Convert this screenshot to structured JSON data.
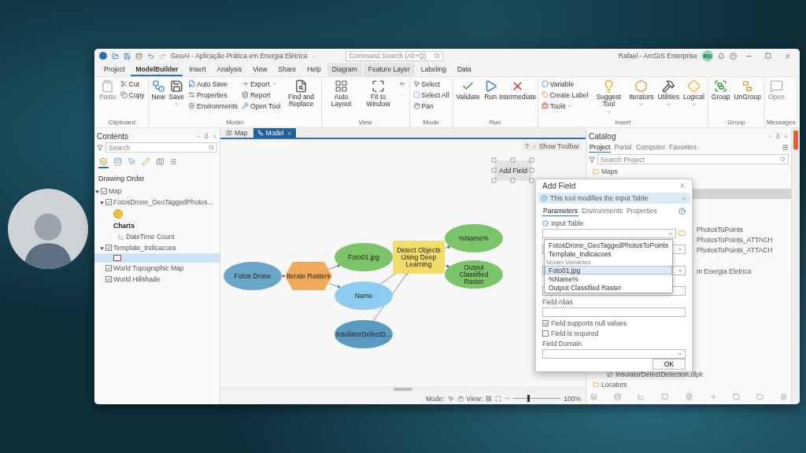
{
  "window": {
    "title": "GeoAI - Aplicação Prática em Energia Elétrica",
    "command_search": {
      "placeholder": "Command Search (Alt+Q)"
    },
    "user": "Rafael - ArcGIS Enterprise",
    "avatar": "RD"
  },
  "menu_tabs": [
    {
      "label": "Project",
      "selected": false,
      "kind": "plain"
    },
    {
      "label": "ModelBuilder",
      "selected": true,
      "kind": "plain"
    },
    {
      "label": "Insert",
      "selected": false,
      "kind": "plain"
    },
    {
      "label": "Analysis",
      "selected": false,
      "kind": "plain"
    },
    {
      "label": "View",
      "selected": false,
      "kind": "plain"
    },
    {
      "label": "Share",
      "selected": false,
      "kind": "plain"
    },
    {
      "label": "Help",
      "selected": false,
      "kind": "plain"
    },
    {
      "label": "Diagram",
      "selected": false,
      "kind": "contextual"
    },
    {
      "label": "Feature Layer",
      "selected": false,
      "kind": "contextual"
    },
    {
      "label": "Labeling",
      "selected": false,
      "kind": "plain"
    },
    {
      "label": "Data",
      "selected": false,
      "kind": "plain"
    }
  ],
  "ribbon": [
    {
      "label": "Clipboard",
      "items": [
        {
          "kind": "large",
          "label": "Paste",
          "disabled": true,
          "dropdown": false
        },
        {
          "kind": "small",
          "label": "Cut",
          "disabled": false,
          "dropdown": false
        },
        {
          "kind": "small",
          "label": "Copy",
          "disabled": false,
          "dropdown": false
        }
      ]
    },
    {
      "label": "Model",
      "items": [
        {
          "kind": "large",
          "label": "New",
          "disabled": false,
          "dropdown": false
        },
        {
          "kind": "large",
          "label": "Save",
          "disabled": false,
          "dropdown": true
        },
        {
          "kind": "small",
          "label": "Auto Save",
          "disabled": false,
          "dropdown": false
        },
        {
          "kind": "small",
          "label": "Properties",
          "disabled": false,
          "dropdown": false
        },
        {
          "kind": "small",
          "label": "Environments",
          "disabled": false,
          "dropdown": false
        },
        {
          "kind": "small",
          "label": "Export",
          "disabled": false,
          "dropdown": true
        },
        {
          "kind": "small",
          "label": "Report",
          "disabled": false,
          "dropdown": false
        },
        {
          "kind": "small",
          "label": "Open Tool",
          "disabled": false,
          "dropdown": false
        },
        {
          "kind": "large",
          "label": "Find and Replace",
          "disabled": false,
          "dropdown": false
        }
      ]
    },
    {
      "label": "View",
      "items": [
        {
          "kind": "large",
          "label": "Auto Layout",
          "disabled": false,
          "dropdown": false
        },
        {
          "kind": "large",
          "label": "Fit to Window",
          "disabled": false,
          "dropdown": false
        },
        {
          "kind": "small",
          "disabled": false,
          "dropdown": false
        },
        {
          "kind": "small",
          "disabled": true,
          "dropdown": false
        }
      ]
    },
    {
      "label": "Mode",
      "items": [
        {
          "kind": "small",
          "label": "Select",
          "disabled": false,
          "dropdown": false
        },
        {
          "kind": "small",
          "label": "Select All",
          "disabled": false,
          "dropdown": false
        },
        {
          "kind": "small",
          "label": "Pan",
          "disabled": false,
          "dropdown": false
        }
      ]
    },
    {
      "label": "Run",
      "items": [
        {
          "kind": "large",
          "label": "Validate",
          "disabled": false,
          "dropdown": false
        },
        {
          "kind": "large",
          "label": "Run",
          "disabled": false,
          "dropdown": false
        },
        {
          "kind": "large",
          "label": "Intermediate",
          "disabled": false,
          "dropdown": false
        }
      ]
    },
    {
      "label": "Insert",
      "items": [
        {
          "kind": "small",
          "label": "Variable",
          "disabled": false,
          "dropdown": false
        },
        {
          "kind": "small",
          "label": "Create Label",
          "disabled": false,
          "dropdown": false
        },
        {
          "kind": "small",
          "label": "Tools",
          "disabled": false,
          "dropdown": true
        },
        {
          "kind": "large",
          "label": "Suggest Tool",
          "disabled": false,
          "dropdown": true
        },
        {
          "kind": "large",
          "label": "Iterators",
          "disabled": false,
          "dropdown": true
        },
        {
          "kind": "large",
          "label": "Utilities",
          "disabled": false,
          "dropdown": true
        },
        {
          "kind": "large",
          "label": "Logical",
          "disabled": false,
          "dropdown": true
        }
      ]
    },
    {
      "label": "Group",
      "items": [
        {
          "kind": "large",
          "label": "Group",
          "disabled": false,
          "dropdown": false
        },
        {
          "kind": "large",
          "label": "UnGroup",
          "disabled": false,
          "dropdown": false
        }
      ]
    },
    {
      "label": "Messages",
      "items": [
        {
          "kind": "large",
          "label": "Open",
          "disabled": true,
          "dropdown": false
        }
      ]
    }
  ],
  "contents": {
    "title": "Contents",
    "search": {
      "placeholder": "Search"
    },
    "heading": "Drawing Order",
    "tree": [
      {
        "kind": "layer",
        "label": "Map",
        "checked": true,
        "expanded": true,
        "children": [
          {
            "kind": "layer",
            "label": "FotosDrone_GeoTaggedPhotos...",
            "checked": true,
            "expanded": true,
            "children": [
              {
                "kind": "symbol",
                "selected": false
              },
              {
                "kind": "heading",
                "label": "Charts"
              },
              {
                "kind": "chart",
                "label": "DateTime Count"
              }
            ]
          },
          {
            "kind": "layer",
            "label": "Template_Indicacoes",
            "checked": true,
            "expanded": true,
            "children": [
              {
                "kind": "symbol",
                "selected": true
              }
            ]
          },
          {
            "kind": "layer",
            "label": "World Topographic Map",
            "checked": true
          },
          {
            "kind": "layer",
            "label": "World Hillshade",
            "checked": true
          }
        ]
      }
    ]
  },
  "canvas": {
    "tabs": [
      {
        "label": "Map",
        "selected": false,
        "closable": false
      },
      {
        "label": "Model",
        "selected": true,
        "closable": true
      }
    ],
    "help": "?",
    "toolbar_toggle": "Show Toolbar",
    "nodes": [
      {
        "kind": "ellipse",
        "label": "Fotos Drone",
        "color": "#6aa6c8"
      },
      {
        "kind": "hexagon",
        "label": "Iterate Rasters",
        "color": "#f0aa5a"
      },
      {
        "kind": "ellipse",
        "label": "Foto01.jpg",
        "color": "#7cc46a"
      },
      {
        "kind": "ellipse",
        "label": "Name",
        "color": "#8ecbf0"
      },
      {
        "kind": "ellipse",
        "label": "InsulatorDefectD...",
        "color": "#5b9ac0"
      },
      {
        "kind": "rect",
        "label": "Detect Objects Using Deep Learning",
        "color": "#f2dc6a"
      },
      {
        "kind": "ellipse",
        "label": "%Name%",
        "color": "#7cc46a"
      },
      {
        "kind": "ellipse",
        "label": "Output Classified Raster",
        "color": "#7cc46a"
      },
      {
        "kind": "selected-tool",
        "label": "Add Field",
        "color": "#e2e2e2"
      }
    ],
    "status": {
      "mode_label": "Mode:",
      "view_label": "View:",
      "zoom": {
        "level": 0.3,
        "reading": "100%"
      }
    }
  },
  "dialog": {
    "title": "Add Field",
    "info": "This tool modifies the Input Table",
    "tabs": [
      {
        "label": "Parameters",
        "selected": true
      },
      {
        "label": "Environments",
        "selected": false
      },
      {
        "label": "Properties",
        "selected": false
      }
    ],
    "input_label": "Input Table",
    "dropdown_items": [
      {
        "kind": "option",
        "label": "FotosDrone_GeoTaggedPhotosToPoints",
        "selected": false
      },
      {
        "kind": "option",
        "label": "Template_Indicacoes",
        "selected": false
      },
      {
        "kind": "header",
        "label": "Model Variables"
      },
      {
        "kind": "option",
        "label": "Foto01.jpg",
        "selected": true
      },
      {
        "kind": "option",
        "label": "%Name%",
        "selected": false
      },
      {
        "kind": "option",
        "label": "Output Classified Raster",
        "selected": false
      }
    ],
    "field_alias_label": "Field Alias",
    "checkboxes": [
      {
        "label": "Field supports null values",
        "checked": true
      },
      {
        "label": "Field is required",
        "checked": false
      }
    ],
    "field_domain_label": "Field Domain",
    "ok": "OK"
  },
  "catalog": {
    "title": "Catalog",
    "tabs": [
      {
        "label": "Project",
        "selected": true
      },
      {
        "label": "Portal",
        "selected": false
      },
      {
        "label": "Computer",
        "selected": false
      },
      {
        "label": "Favorites",
        "selected": false
      }
    ],
    "search": {
      "placeholder": "Search Project"
    },
    "rows": [
      {
        "kind": "folder",
        "label": "Maps",
        "selected": false
      },
      {
        "kind": "covered",
        "selected": true
      },
      {
        "kind": "covered",
        "label": "PhotosToPoints",
        "selected": false
      },
      {
        "kind": "covered",
        "label": "PhotosToPoints_ATTACH",
        "selected": false
      },
      {
        "kind": "covered",
        "label": "PhotosToPoints_ATTACH",
        "selected": false
      },
      {
        "kind": "covered",
        "label": "m Energia Eletrica",
        "selected": false
      },
      {
        "kind": "file",
        "label": "InsulatorDefectDetection.dlpk",
        "selected": false
      },
      {
        "kind": "folder",
        "label": "Locators",
        "selected": false
      }
    ]
  }
}
